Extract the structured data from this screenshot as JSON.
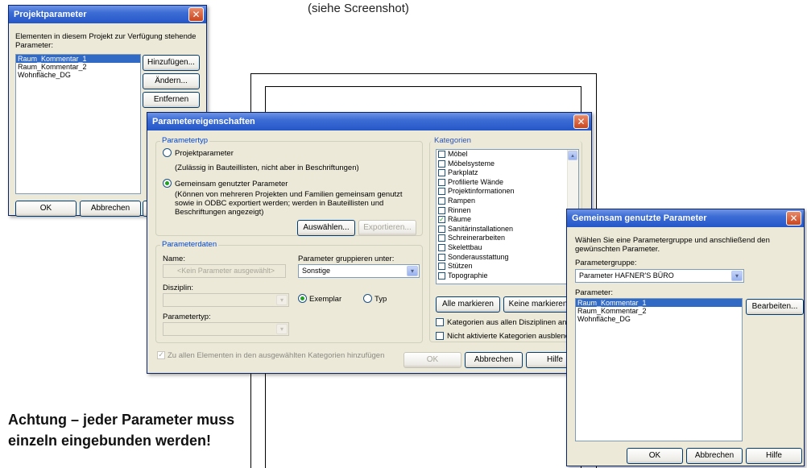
{
  "caption": "(siehe Screenshot)",
  "warning": [
    "Achtung – jeder Parameter muss",
    "einzeln eingebunden werden!"
  ],
  "projektparameter": {
    "title": "Projektparameter",
    "description": "Elementen in diesem Projekt zur Verfügung stehende Parameter:",
    "items": [
      "Raum_Kommentar_1",
      "Raum_Kommentar_2",
      "Wohnfläche_DG"
    ],
    "selected_index": 0,
    "buttons": {
      "add": "Hinzufügen...",
      "modify": "Ändern...",
      "remove": "Entfernen",
      "ok": "OK",
      "cancel": "Abbrechen"
    }
  },
  "parametereigenschaften": {
    "title": "Parametereigenschaften",
    "parametertyp": {
      "legend": "Parametertyp",
      "option_project": "Projektparameter",
      "option_project_note": "(Zulässig in Bauteillisten, nicht aber in Beschriftungen)",
      "option_shared": "Gemeinsam genutzter Parameter",
      "option_shared_note": "(Können von mehreren Projekten und Familien gemeinsam genutzt sowie in ODBC exportiert werden; werden in Bauteillisten und Beschriftungen angezeigt)",
      "selected": "option_shared",
      "btn_select": "Auswählen...",
      "btn_export": "Exportieren..."
    },
    "parameterdaten": {
      "legend": "Parameterdaten",
      "name_label": "Name:",
      "name_value": "<Kein Parameter ausgewählt>",
      "group_label": "Parameter gruppieren unter:",
      "group_value": "Sonstige",
      "discipline_label": "Disziplin:",
      "type_label": "Parametertyp:",
      "radio_instance": "Exemplar",
      "radio_type": "Typ",
      "radio_selected": "radio_instance"
    },
    "add_to_all": "Zu allen Elementen in den ausgewählten Kategorien hinzufügen",
    "kategorien": {
      "legend": "Kategorien",
      "items": [
        {
          "label": "Möbel",
          "checked": false
        },
        {
          "label": "Möbelsysteme",
          "checked": false
        },
        {
          "label": "Parkplatz",
          "checked": false
        },
        {
          "label": "Profilierte Wände",
          "checked": false
        },
        {
          "label": "Projektinformationen",
          "checked": false
        },
        {
          "label": "Rampen",
          "checked": false
        },
        {
          "label": "Rinnen",
          "checked": false
        },
        {
          "label": "Räume",
          "checked": true
        },
        {
          "label": "Sanitärinstallationen",
          "checked": false
        },
        {
          "label": "Schreinerarbeiten",
          "checked": false
        },
        {
          "label": "Skelettbau",
          "checked": false
        },
        {
          "label": "Sonderausstattung",
          "checked": false
        },
        {
          "label": "Stützen",
          "checked": false
        },
        {
          "label": "Topographie",
          "checked": false
        }
      ],
      "btn_mark_all": "Alle markieren",
      "btn_mark_none": "Keine markieren",
      "check_all_disciplines": "Kategorien aus allen Disziplinen anzeigen",
      "check_hide_inactive": "Nicht aktivierte Kategorien ausblenden"
    },
    "buttons": {
      "ok": "OK",
      "cancel": "Abbrechen",
      "help": "Hilfe"
    }
  },
  "gemeinsam": {
    "title": "Gemeinsam genutzte Parameter",
    "description": "Wählen Sie eine Parametergruppe und anschließend den gewünschten Parameter.",
    "group_label": "Parametergruppe:",
    "group_value": "Parameter HAFNER'S BÜRO",
    "params_label": "Parameter:",
    "items": [
      "Raum_Kommentar_1",
      "Raum_Kommentar_2",
      "Wohnfläche_DG"
    ],
    "selected_index": 0,
    "buttons": {
      "edit": "Bearbeiten...",
      "ok": "OK",
      "cancel": "Abbrechen",
      "help": "Hilfe"
    }
  },
  "icons": {
    "close": "✕",
    "dropdown": "▾",
    "scroll_up": "▴",
    "checkmark": "✓"
  }
}
